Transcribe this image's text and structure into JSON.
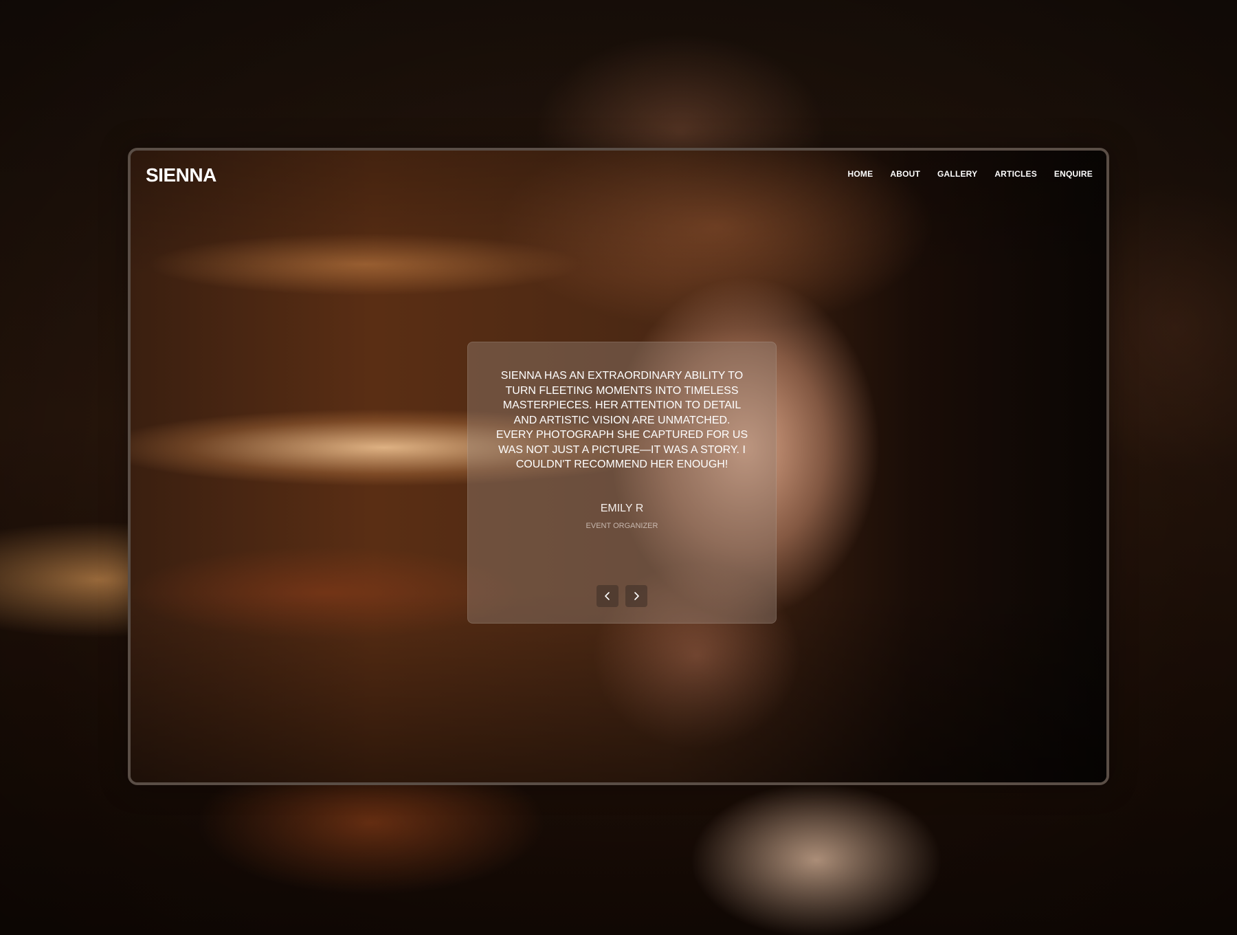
{
  "site": {
    "logo": "SIENNA"
  },
  "nav": {
    "items": [
      {
        "label": "HOME"
      },
      {
        "label": "ABOUT"
      },
      {
        "label": "GALLERY"
      },
      {
        "label": "ARTICLES"
      },
      {
        "label": "ENQUIRE"
      }
    ]
  },
  "testimonial": {
    "quote": "SIENNA HAS AN EXTRAORDINARY ABILITY TO TURN FLEETING MOMENTS INTO TIMELESS MASTERPIECES. HER ATTENTION TO DETAIL AND ARTISTIC VISION ARE UNMATCHED. EVERY PHOTOGRAPH SHE CAPTURED FOR US WAS NOT JUST A PICTURE—IT WAS A STORY. I COULDN'T RECOMMEND HER ENOUGH!",
    "author": "EMILY R",
    "role": "EVENT ORGANIZER",
    "prev_icon": "chevron-left-icon",
    "next_icon": "chevron-right-icon"
  }
}
